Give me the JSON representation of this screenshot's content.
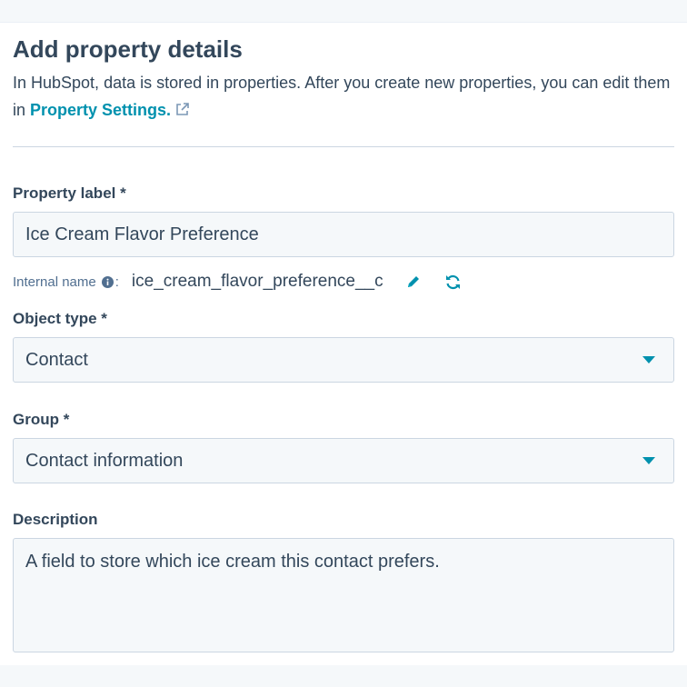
{
  "header": {
    "title": "Add property details",
    "intro_text": "In HubSpot, data is stored in properties. After you create new properties, you can edit them in ",
    "settings_link": "Property Settings."
  },
  "property_label": {
    "label": "Property label *",
    "value": "Ice Cream Flavor Preference"
  },
  "internal_name": {
    "label": "Internal name",
    "colon": ":",
    "value": "ice_cream_flavor_preference__c"
  },
  "object_type": {
    "label": "Object type *",
    "selected": "Contact"
  },
  "group": {
    "label": "Group *",
    "selected": "Contact information"
  },
  "description": {
    "label": "Description",
    "value": "A field to store which ice cream this contact prefers."
  },
  "colors": {
    "accent": "#0091ae",
    "text": "#33475b",
    "field_bg": "#f5f8fa",
    "border": "#cbd6e2"
  },
  "icons": [
    "external-link-icon",
    "info-icon",
    "pencil-icon",
    "refresh-icon",
    "caret-down-icon"
  ]
}
